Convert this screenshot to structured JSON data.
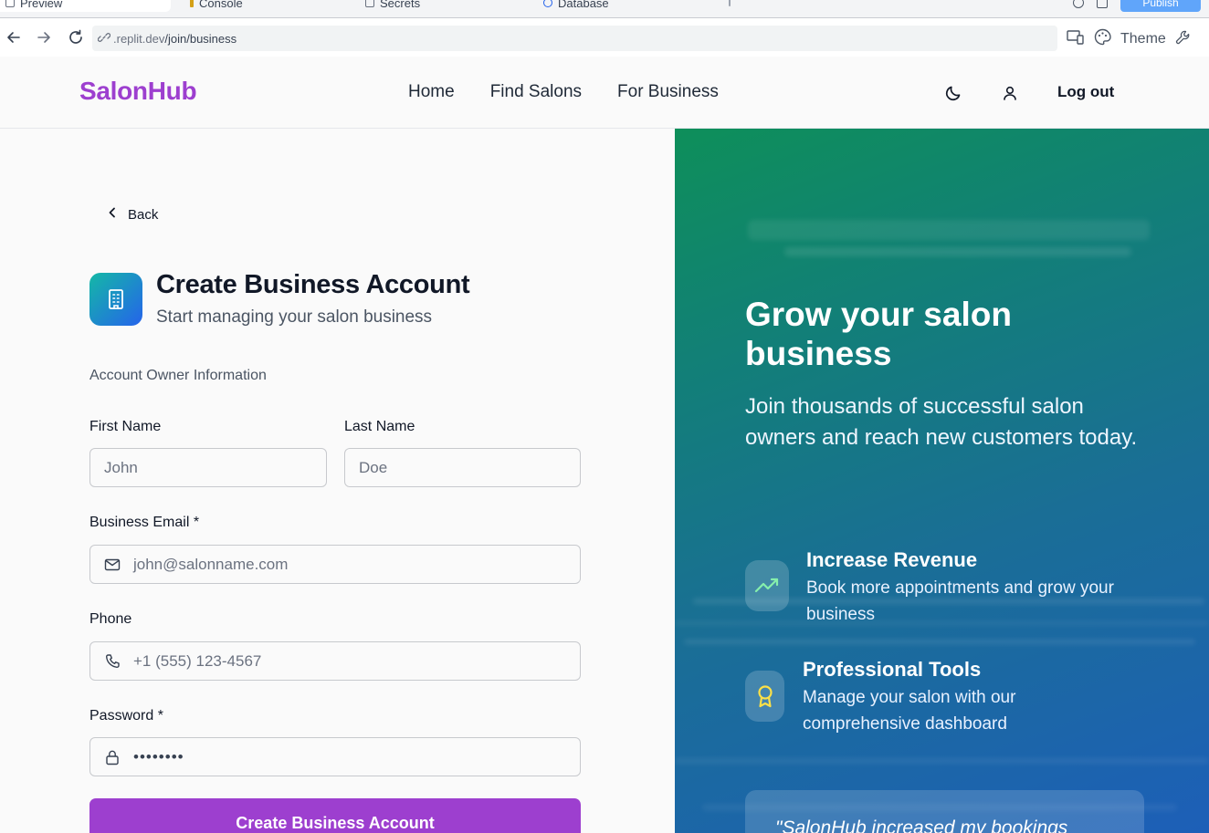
{
  "browser": {
    "tabs": [
      {
        "label": "Preview",
        "icon": "preview-icon"
      },
      {
        "label": "Console",
        "icon": "key-icon"
      },
      {
        "label": "Secrets",
        "icon": "lock-icon"
      },
      {
        "label": "Database",
        "icon": "database-icon"
      }
    ],
    "publish_label": "Publish",
    "url_domain": ".replit.dev",
    "url_path": "/join/business",
    "theme_label": "Theme"
  },
  "header": {
    "logo": "SalonHub",
    "nav": [
      "Home",
      "Find Salons",
      "For Business"
    ],
    "logout_label": "Log out"
  },
  "form": {
    "back_label": "Back",
    "title": "Create Business Account",
    "subtitle": "Start managing your salon business",
    "section_label": "Account Owner Information",
    "first_name": {
      "label": "First Name",
      "placeholder": "John",
      "value": ""
    },
    "last_name": {
      "label": "Last Name",
      "placeholder": "Doe",
      "value": ""
    },
    "email": {
      "label": "Business Email *",
      "placeholder": "john@salonname.com",
      "value": ""
    },
    "phone": {
      "label": "Phone",
      "placeholder": "+1 (555) 123-4567",
      "value": ""
    },
    "password": {
      "label": "Password *",
      "placeholder": "••••••••",
      "value": ""
    },
    "submit_label": "Create Business Account"
  },
  "hero": {
    "title": "Grow your salon business",
    "subtitle": "Join thousands of successful salon owners and reach new customers today.",
    "features": [
      {
        "title": "Increase Revenue",
        "description": "Book more appointments and grow your business",
        "icon": "trending-up-icon",
        "icon_color": "#86efac"
      },
      {
        "title": "Professional Tools",
        "description": "Manage your salon with our comprehensive dashboard",
        "icon": "award-icon",
        "icon_color": "#fde047"
      }
    ],
    "quote": "\"SalonHub increased my bookings"
  },
  "colors": {
    "brand": "#9d3fcf",
    "hero_gradient_start": "#0e8f5a",
    "hero_gradient_end": "#1d5fb8",
    "badge_gradient_start": "#14b8a6",
    "badge_gradient_end": "#2563eb"
  }
}
